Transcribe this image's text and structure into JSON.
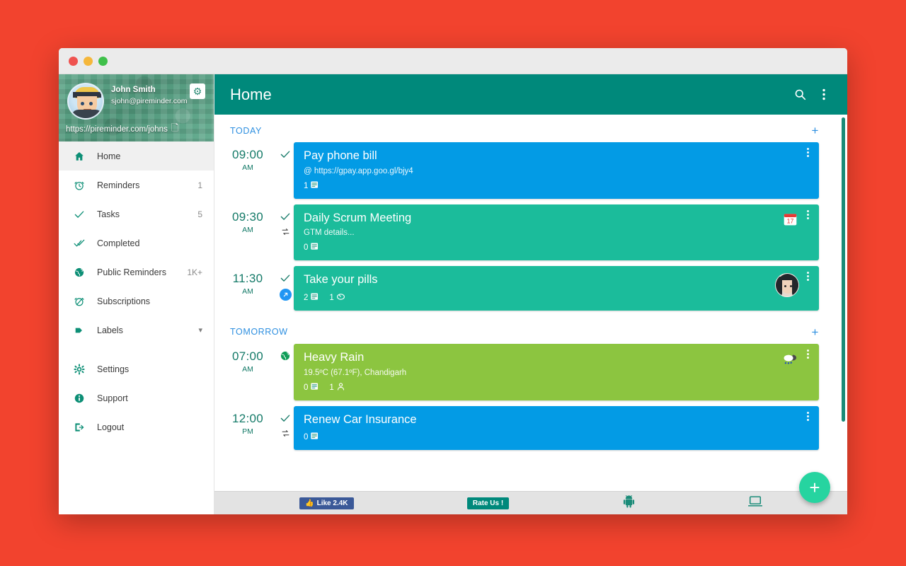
{
  "window": {
    "traffic_lights": [
      "close",
      "minimize",
      "maximize"
    ]
  },
  "profile": {
    "name": "John Smith",
    "email": "sjohn@pireminder.com",
    "url": "https://pireminder.com/johns",
    "settings_icon": "gear-icon",
    "copy_icon": "copy-icon",
    "avatar_icon": "user-avatar"
  },
  "sidebar": {
    "items": [
      {
        "label": "Home",
        "icon": "home-icon",
        "count": "",
        "active": true
      },
      {
        "label": "Reminders",
        "icon": "alarm-clock-icon",
        "count": "1",
        "active": false
      },
      {
        "label": "Tasks",
        "icon": "check-icon",
        "count": "5",
        "active": false
      },
      {
        "label": "Completed",
        "icon": "double-check-icon",
        "count": "",
        "active": false
      },
      {
        "label": "Public Reminders",
        "icon": "globe-icon",
        "count": "1K+",
        "active": false
      },
      {
        "label": "Subscriptions",
        "icon": "alarm-off-icon",
        "count": "",
        "active": false
      },
      {
        "label": "Labels",
        "icon": "tag-icon",
        "count": "",
        "active": false,
        "chevron": "⌄"
      },
      {
        "label": "Settings",
        "icon": "gear-icon",
        "count": "",
        "active": false
      },
      {
        "label": "Support",
        "icon": "info-icon",
        "count": "",
        "active": false
      },
      {
        "label": "Logout",
        "icon": "logout-icon",
        "count": "",
        "active": false
      }
    ]
  },
  "topbar": {
    "title": "Home",
    "search_icon": "search-icon",
    "overflow_icon": "kebab-menu-icon"
  },
  "sections": [
    {
      "label": "TODAY",
      "add_label": "+"
    },
    {
      "label": "TOMORROW",
      "add_label": "+"
    }
  ],
  "reminders": {
    "today": [
      {
        "time": "09:00",
        "meridiem": "AM",
        "title": "Pay phone bill",
        "subtitle": "@ https://gpay.app.goo.gl/bjy4",
        "color": "#039be5",
        "status_icons": [
          "check-icon"
        ],
        "badges": [
          {
            "icon": "notes-icon",
            "count": "1"
          }
        ],
        "right_icon": "",
        "right_avatar": false
      },
      {
        "time": "09:30",
        "meridiem": "AM",
        "title": "Daily Scrum Meeting",
        "subtitle": "GTM details...",
        "color": "#1bbc9b",
        "status_icons": [
          "check-icon",
          "repeat-icon"
        ],
        "badges": [
          {
            "icon": "notes-icon",
            "count": "0"
          }
        ],
        "right_icon": "calendar-icon",
        "right_avatar": false
      },
      {
        "time": "11:30",
        "meridiem": "AM",
        "title": "Take your pills",
        "subtitle": "",
        "color": "#1bbc9b",
        "status_icons": [
          "check-icon",
          "share-icon"
        ],
        "badges": [
          {
            "icon": "notes-icon",
            "count": "2"
          },
          {
            "icon": "cycle-icon",
            "count": "1"
          }
        ],
        "right_icon": "",
        "right_avatar": true
      }
    ],
    "tomorrow": [
      {
        "time": "07:00",
        "meridiem": "AM",
        "title": "Heavy Rain",
        "subtitle": "19.5ºC (67.1ºF), Chandigarh",
        "color": "#8cc540",
        "status_icons": [
          "globe-icon"
        ],
        "badges": [
          {
            "icon": "notes-icon",
            "count": "0"
          },
          {
            "icon": "person-icon",
            "count": "1"
          }
        ],
        "right_icon": "rain-cloud-icon",
        "right_avatar": false
      },
      {
        "time": "12:00",
        "meridiem": "PM",
        "title": "Renew Car Insurance",
        "subtitle": "",
        "color": "#039be5",
        "status_icons": [
          "check-icon",
          "repeat-icon"
        ],
        "badges": [
          {
            "icon": "notes-icon",
            "count": "0"
          }
        ],
        "right_icon": "",
        "right_avatar": false
      }
    ]
  },
  "fab": {
    "label": "+",
    "icon": "add-icon"
  },
  "footer": {
    "facebook_like": "Like 2.4K",
    "rate_us": "Rate Us !",
    "android_icon": "android-icon",
    "desktop_icon": "desktop-icon"
  },
  "colors": {
    "brand_teal": "#00897b",
    "accent_blue": "#039be5",
    "accent_green": "#1bbc9b",
    "accent_lime": "#8cc540",
    "page_bg": "#f2432e",
    "section_label": "#2d8fe0"
  }
}
